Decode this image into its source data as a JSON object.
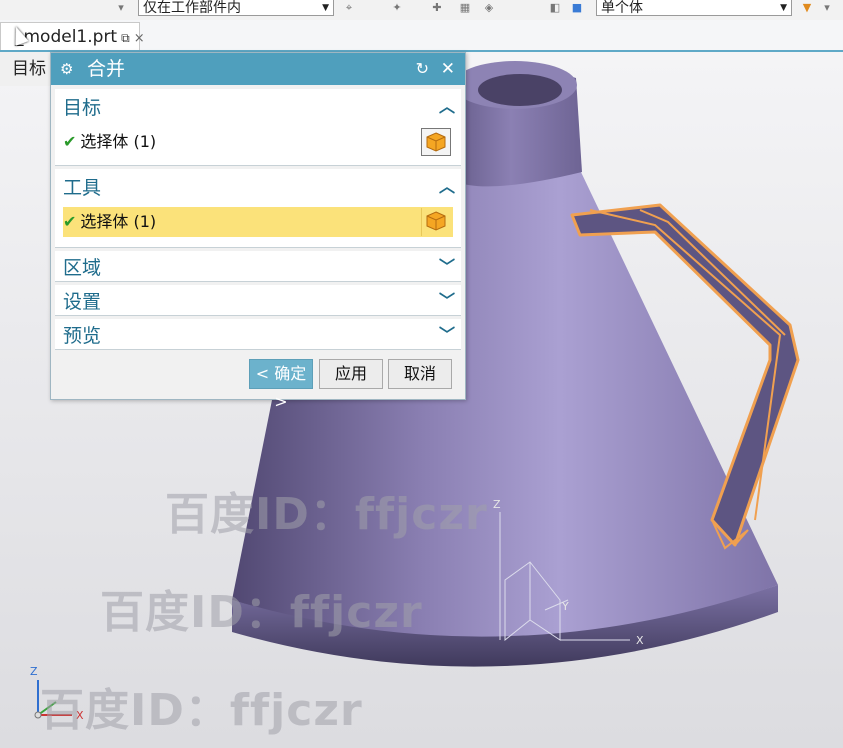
{
  "toolbar": {
    "dropdown1": "仅在工作部件内",
    "dropdown2": "单个体"
  },
  "tab": {
    "title": "_model1.prt",
    "pin_glyph": "⧉",
    "close_glyph": "×"
  },
  "filter_label": "目标",
  "dialog": {
    "title": "合并",
    "target": {
      "header": "目标",
      "row": "选择体 (1)"
    },
    "tool": {
      "header": "工具",
      "row": "选择体 (1)"
    },
    "region": "区域",
    "settings": "设置",
    "preview": "预览",
    "buttons": {
      "ok": "< 确定 >",
      "apply": "应用",
      "cancel": "取消"
    }
  },
  "watermark": "百度ID：ffjczr",
  "axes": {
    "z": "Z",
    "y": "Y",
    "x": "X"
  },
  "colors": {
    "title_bar": "#4f9fbd",
    "accent": "#1f6c8c",
    "selection": "#fbe27a",
    "body": "#8e82b4",
    "handle_outline": "#f0a050"
  }
}
